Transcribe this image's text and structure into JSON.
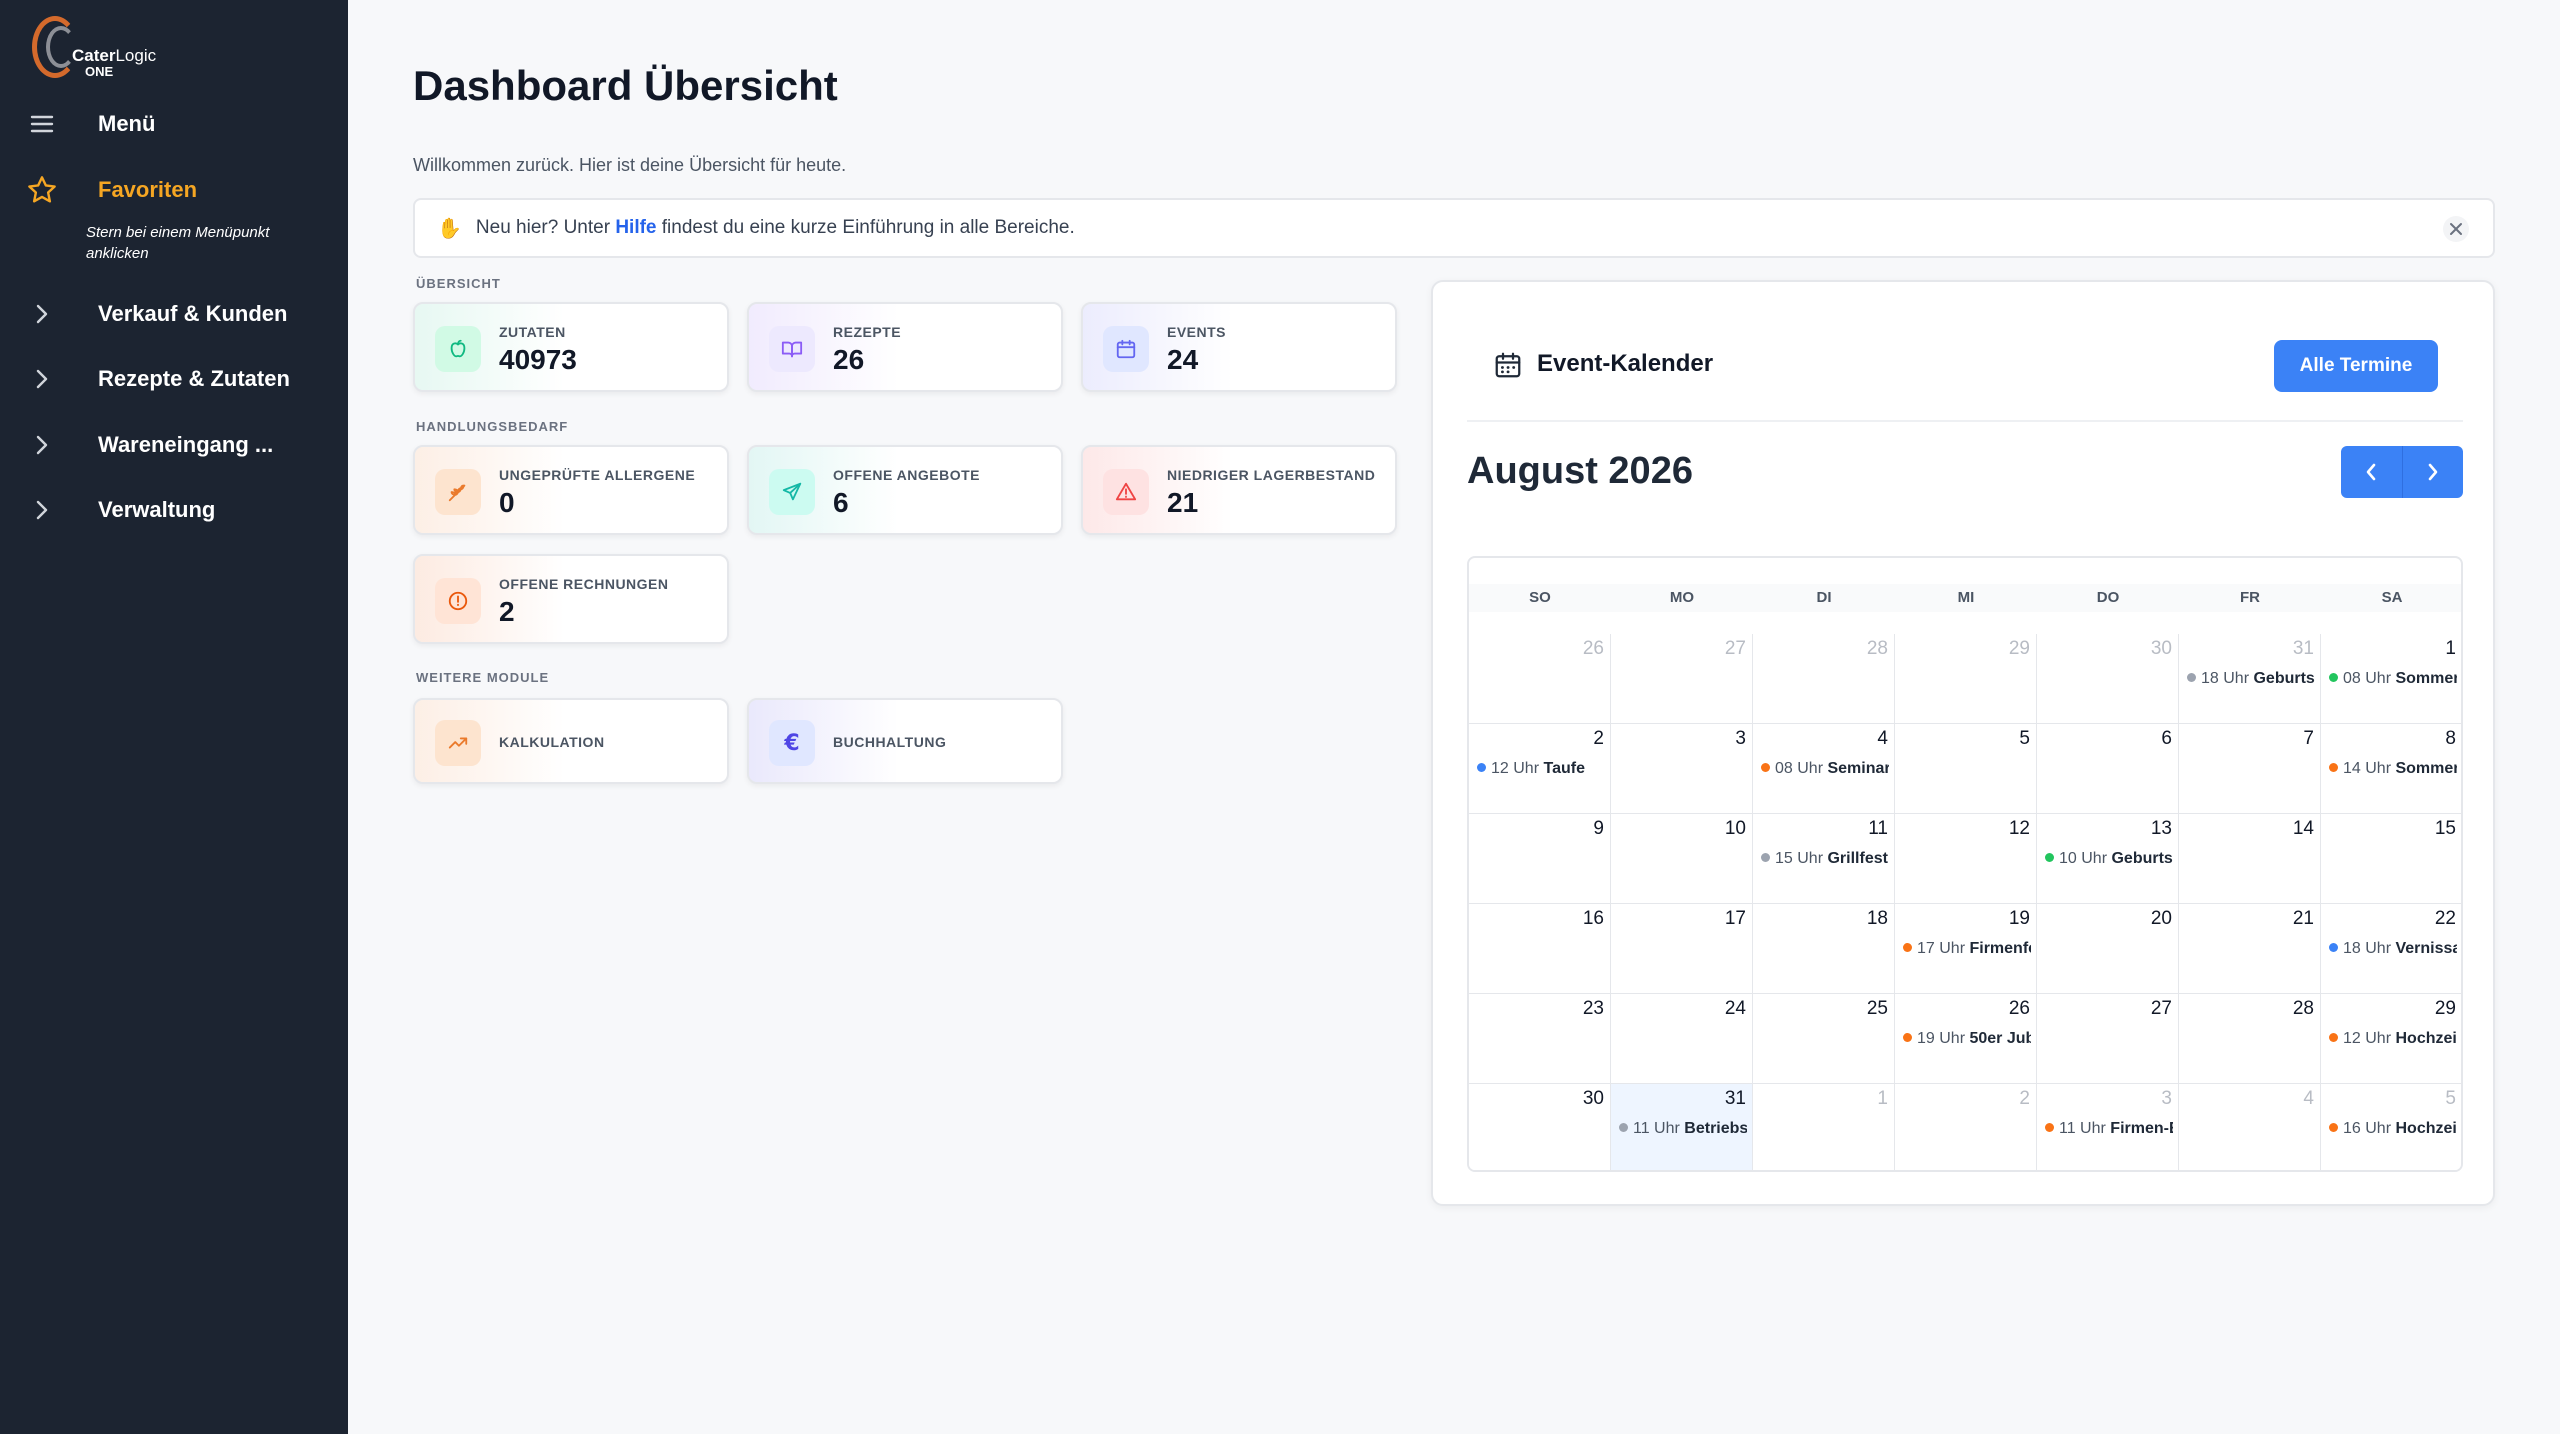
{
  "brand": {
    "line1a": "Cater",
    "line1b": "Logic",
    "line2": "ONE"
  },
  "sidebar": {
    "menu_label": "Menü",
    "favorites": {
      "label": "Favoriten",
      "hint": "Stern bei einem Menüpunkt anklicken"
    },
    "items": [
      {
        "label": "Verkauf & Kunden"
      },
      {
        "label": "Rezepte & Zutaten"
      },
      {
        "label": "Wareneingang ..."
      },
      {
        "label": "Verwaltung"
      }
    ]
  },
  "header": {
    "title": "Dashboard Übersicht",
    "subtitle": "Willkommen zurück. Hier ist deine Übersicht für heute."
  },
  "banner": {
    "pre": "Neu hier? Unter ",
    "link": "Hilfe",
    "post": " findest du eine kurze Einführung in alle Bereiche."
  },
  "sections": {
    "overview": "ÜBERSICHT",
    "action": "HANDLUNGSBEDARF",
    "modules": "WEITERE MODULE"
  },
  "overview_cards": [
    {
      "label": "ZUTATEN",
      "value": "40973",
      "icon": "apple-icon",
      "color": "#10b981"
    },
    {
      "label": "REZEPTE",
      "value": "26",
      "icon": "book-icon",
      "color": "#8b5cf6"
    },
    {
      "label": "EVENTS",
      "value": "24",
      "icon": "calendar-icon",
      "color": "#6366f1"
    }
  ],
  "action_cards": [
    {
      "label": "UNGEPRÜFTE ALLERGENE",
      "value": "0",
      "icon": "wheat-icon",
      "color": "#ea7a2c"
    },
    {
      "label": "OFFENE ANGEBOTE",
      "value": "6",
      "icon": "send-icon",
      "color": "#14b8a6"
    },
    {
      "label": "NIEDRIGER LAGERBESTAND",
      "value": "21",
      "icon": "warning-icon",
      "color": "#ef4444"
    },
    {
      "label": "OFFENE RECHNUNGEN",
      "value": "2",
      "icon": "alert-circle-icon",
      "color": "#ea580c"
    }
  ],
  "module_cards": [
    {
      "label": "KALKULATION",
      "icon": "trend-up-icon",
      "color": "#ea7a2c"
    },
    {
      "label": "BUCHHALTUNG",
      "icon": "euro-icon",
      "color": "#4f46e5"
    }
  ],
  "calendar": {
    "title": "Event-Kalender",
    "all_button": "Alle Termine",
    "month": "August 2026",
    "weekdays": [
      "SO",
      "MO",
      "DI",
      "MI",
      "DO",
      "FR",
      "SA"
    ],
    "colors": {
      "orange": "#f97316",
      "blue": "#3b82f6",
      "green": "#22c55e",
      "gray": "#9ca3af"
    },
    "weeks": [
      [
        {
          "d": "26",
          "o": true
        },
        {
          "d": "27",
          "o": true
        },
        {
          "d": "28",
          "o": true
        },
        {
          "d": "29",
          "o": true
        },
        {
          "d": "30",
          "o": true
        },
        {
          "d": "31",
          "o": true,
          "t": "18 Uhr",
          "n": "Geburtst",
          "c": "gray"
        },
        {
          "d": "1",
          "t": "08 Uhr",
          "n": "Sommer",
          "c": "green"
        }
      ],
      [
        {
          "d": "2",
          "t": "12 Uhr",
          "n": "Taufe",
          "c": "blue"
        },
        {
          "d": "3"
        },
        {
          "d": "4",
          "t": "08 Uhr",
          "n": "Seminar",
          "c": "orange"
        },
        {
          "d": "5"
        },
        {
          "d": "6"
        },
        {
          "d": "7"
        },
        {
          "d": "8",
          "t": "14 Uhr",
          "n": "Sommer",
          "c": "orange"
        }
      ],
      [
        {
          "d": "9"
        },
        {
          "d": "10"
        },
        {
          "d": "11",
          "t": "15 Uhr",
          "n": "Grillfest",
          "c": "gray"
        },
        {
          "d": "12"
        },
        {
          "d": "13",
          "t": "10 Uhr",
          "n": "Geburtst",
          "c": "green"
        },
        {
          "d": "14"
        },
        {
          "d": "15"
        }
      ],
      [
        {
          "d": "16"
        },
        {
          "d": "17"
        },
        {
          "d": "18"
        },
        {
          "d": "19",
          "t": "17 Uhr",
          "n": "Firmenfe",
          "c": "orange"
        },
        {
          "d": "20"
        },
        {
          "d": "21"
        },
        {
          "d": "22",
          "t": "18 Uhr",
          "n": "Vernissa",
          "c": "blue"
        }
      ],
      [
        {
          "d": "23"
        },
        {
          "d": "24"
        },
        {
          "d": "25"
        },
        {
          "d": "26",
          "t": "19 Uhr",
          "n": "50er Jub",
          "c": "orange"
        },
        {
          "d": "27"
        },
        {
          "d": "28"
        },
        {
          "d": "29",
          "t": "12 Uhr",
          "n": "Hochzeit",
          "c": "orange"
        }
      ],
      [
        {
          "d": "30"
        },
        {
          "d": "31",
          "today": true,
          "t": "11 Uhr",
          "n": "Betriebsa",
          "c": "gray"
        },
        {
          "d": "1",
          "o": true
        },
        {
          "d": "2",
          "o": true
        },
        {
          "d": "3",
          "o": true,
          "t": "11 Uhr",
          "n": "Firmen-E",
          "c": "orange"
        },
        {
          "d": "4",
          "o": true
        },
        {
          "d": "5",
          "o": true,
          "t": "16 Uhr",
          "n": "Hochzeit",
          "c": "orange"
        }
      ]
    ]
  }
}
